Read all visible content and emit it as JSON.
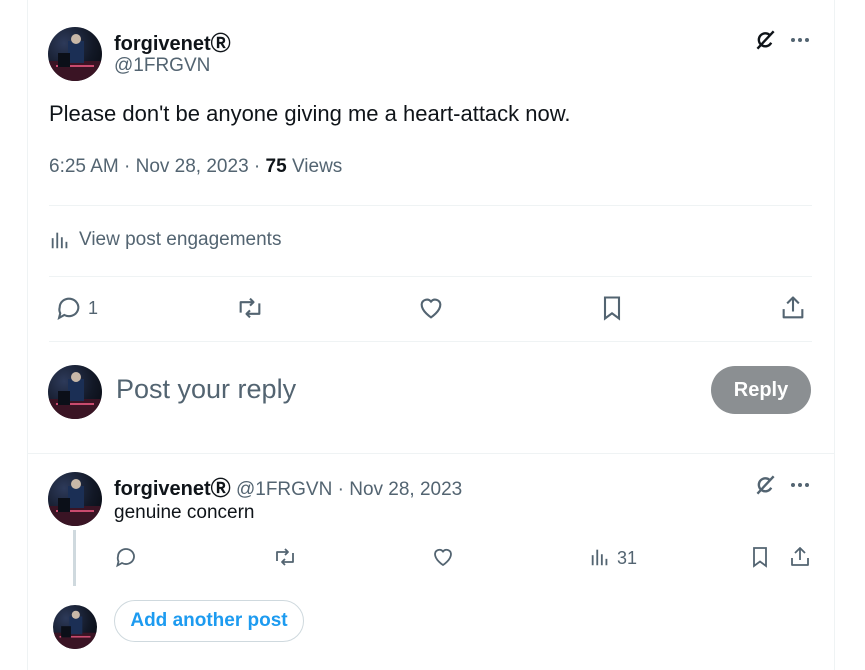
{
  "main_post": {
    "author_name": "forgivenetⓇ",
    "handle": "@1FRGVN",
    "text": "Please don't be anyone giving me a heart-attack now.",
    "time": "6:25 AM",
    "date": "Nov 28, 2023",
    "views_count": "75",
    "views_label": "Views",
    "engagements_label": "View post engagements",
    "reply_count": "1"
  },
  "reply_box": {
    "placeholder": "Post your reply",
    "button_label": "Reply"
  },
  "thread_post": {
    "author_name": "forgivenetⓇ",
    "handle": "@1FRGVN",
    "date": "Nov 28, 2023",
    "text": "genuine concern",
    "views_count": "31"
  },
  "add_post_label": "Add another post",
  "separator": "·",
  "icons": {
    "grok": "grok-icon",
    "more": "more-icon",
    "chart": "analytics-icon",
    "reply": "reply-icon",
    "repost": "repost-icon",
    "like": "like-icon",
    "bookmark": "bookmark-icon",
    "share": "share-icon"
  }
}
